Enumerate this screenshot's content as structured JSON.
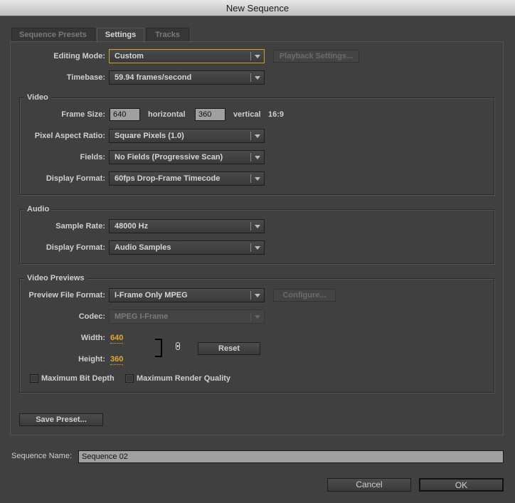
{
  "window": {
    "title": "New Sequence"
  },
  "tabs": [
    {
      "label": "Sequence Presets",
      "active": false
    },
    {
      "label": "Settings",
      "active": true
    },
    {
      "label": "Tracks",
      "active": false
    }
  ],
  "general": {
    "editing_mode": {
      "label": "Editing Mode:",
      "value": "Custom"
    },
    "playback_settings_button": "Playback Settings...",
    "timebase": {
      "label": "Timebase:",
      "value": "59.94 frames/second"
    }
  },
  "video": {
    "title": "Video",
    "frame_size": {
      "label": "Frame Size:",
      "horizontal": "640",
      "horizontal_label": "horizontal",
      "vertical": "360",
      "vertical_label": "vertical",
      "aspect": "16:9"
    },
    "pixel_aspect_ratio": {
      "label": "Pixel Aspect Ratio:",
      "value": "Square Pixels (1.0)"
    },
    "fields": {
      "label": "Fields:",
      "value": "No Fields (Progressive Scan)"
    },
    "display_format": {
      "label": "Display Format:",
      "value": "60fps Drop-Frame Timecode"
    }
  },
  "audio": {
    "title": "Audio",
    "sample_rate": {
      "label": "Sample Rate:",
      "value": "48000 Hz"
    },
    "display_format": {
      "label": "Display Format:",
      "value": "Audio Samples"
    }
  },
  "video_previews": {
    "title": "Video Previews",
    "preview_file_format": {
      "label": "Preview File Format:",
      "value": "I-Frame Only MPEG"
    },
    "configure_button": "Configure...",
    "codec": {
      "label": "Codec:",
      "value": "MPEG I-Frame"
    },
    "width": {
      "label": "Width:",
      "value": "640"
    },
    "height": {
      "label": "Height:",
      "value": "360"
    },
    "reset_button": "Reset",
    "max_bit_depth": {
      "label": "Maximum Bit Depth",
      "checked": false
    },
    "max_render_quality": {
      "label": "Maximum Render Quality",
      "checked": false
    }
  },
  "save_preset_button": "Save Preset...",
  "sequence_name": {
    "label": "Sequence Name:",
    "value": "Sequence 02"
  },
  "buttons": {
    "cancel": "Cancel",
    "ok": "OK"
  },
  "colors": {
    "accent": "#e3a82a",
    "focus": "#d4a020",
    "background": "#404040"
  }
}
